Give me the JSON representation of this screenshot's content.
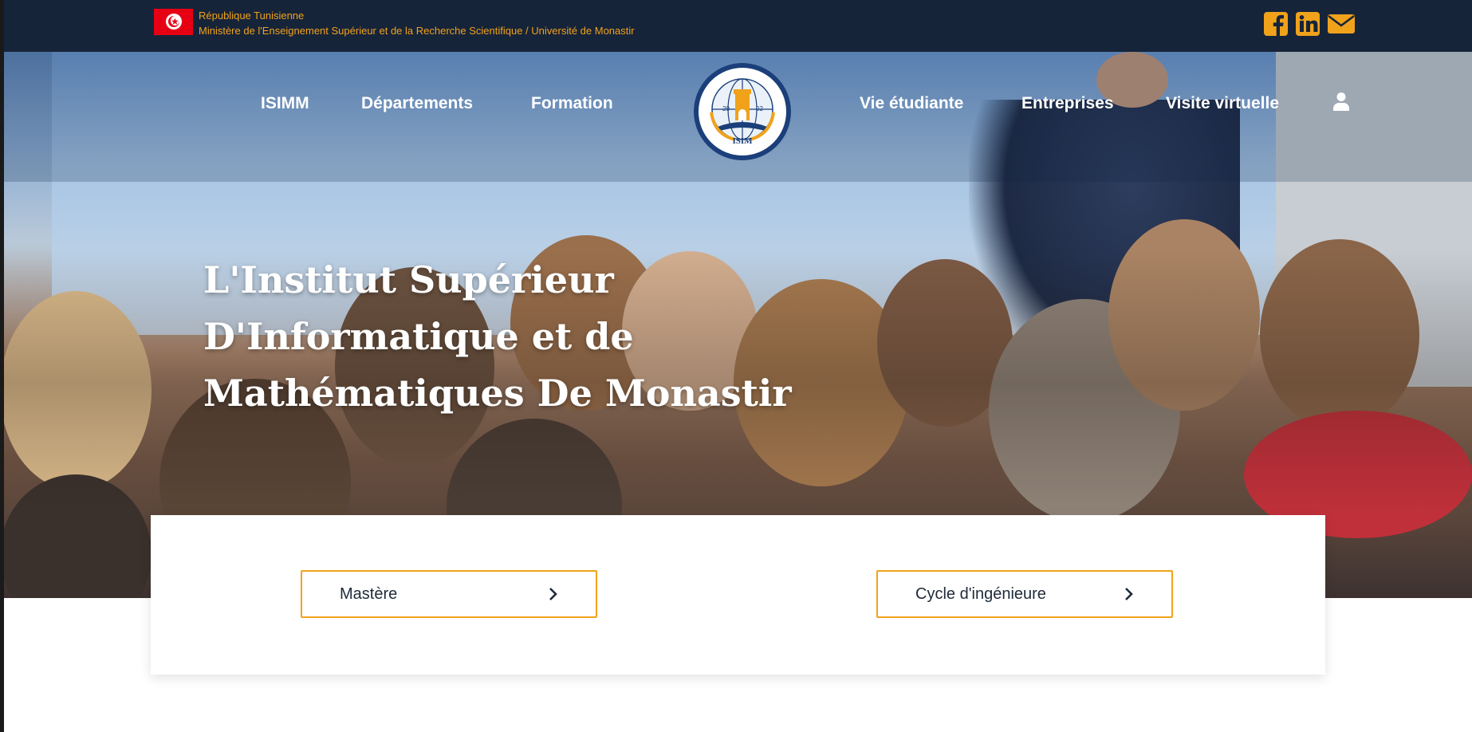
{
  "topbar": {
    "republic": "République Tunisienne",
    "ministry": "Ministère de l'Enseignement Supérieur et de la Recherche Scientifique / Université de Monastir",
    "accent_color": "#f0a21b",
    "background": "#16243a",
    "social_icons": [
      "facebook-icon",
      "linkedin-icon",
      "mail-icon"
    ]
  },
  "nav": {
    "left_items": [
      "ISIMM",
      "Départements",
      "Formation"
    ],
    "right_items": [
      "Vie étudiante",
      "Entreprises",
      "Visite virtuelle"
    ],
    "logo_text": "ISIM",
    "logo_digits_left": "20",
    "logo_digits_right": "02",
    "user_icon": "user-icon"
  },
  "hero": {
    "title_lines": [
      "L'Institut Supérieur",
      "D'Informatique et de",
      "Mathématiques De Monastir"
    ]
  },
  "cards": {
    "buttons": [
      {
        "label": "Mastère",
        "icon": "chevron-right-icon"
      },
      {
        "label": "Cycle d'ingénieure",
        "icon": "chevron-right-icon"
      }
    ],
    "border_color": "#f2a31a"
  }
}
